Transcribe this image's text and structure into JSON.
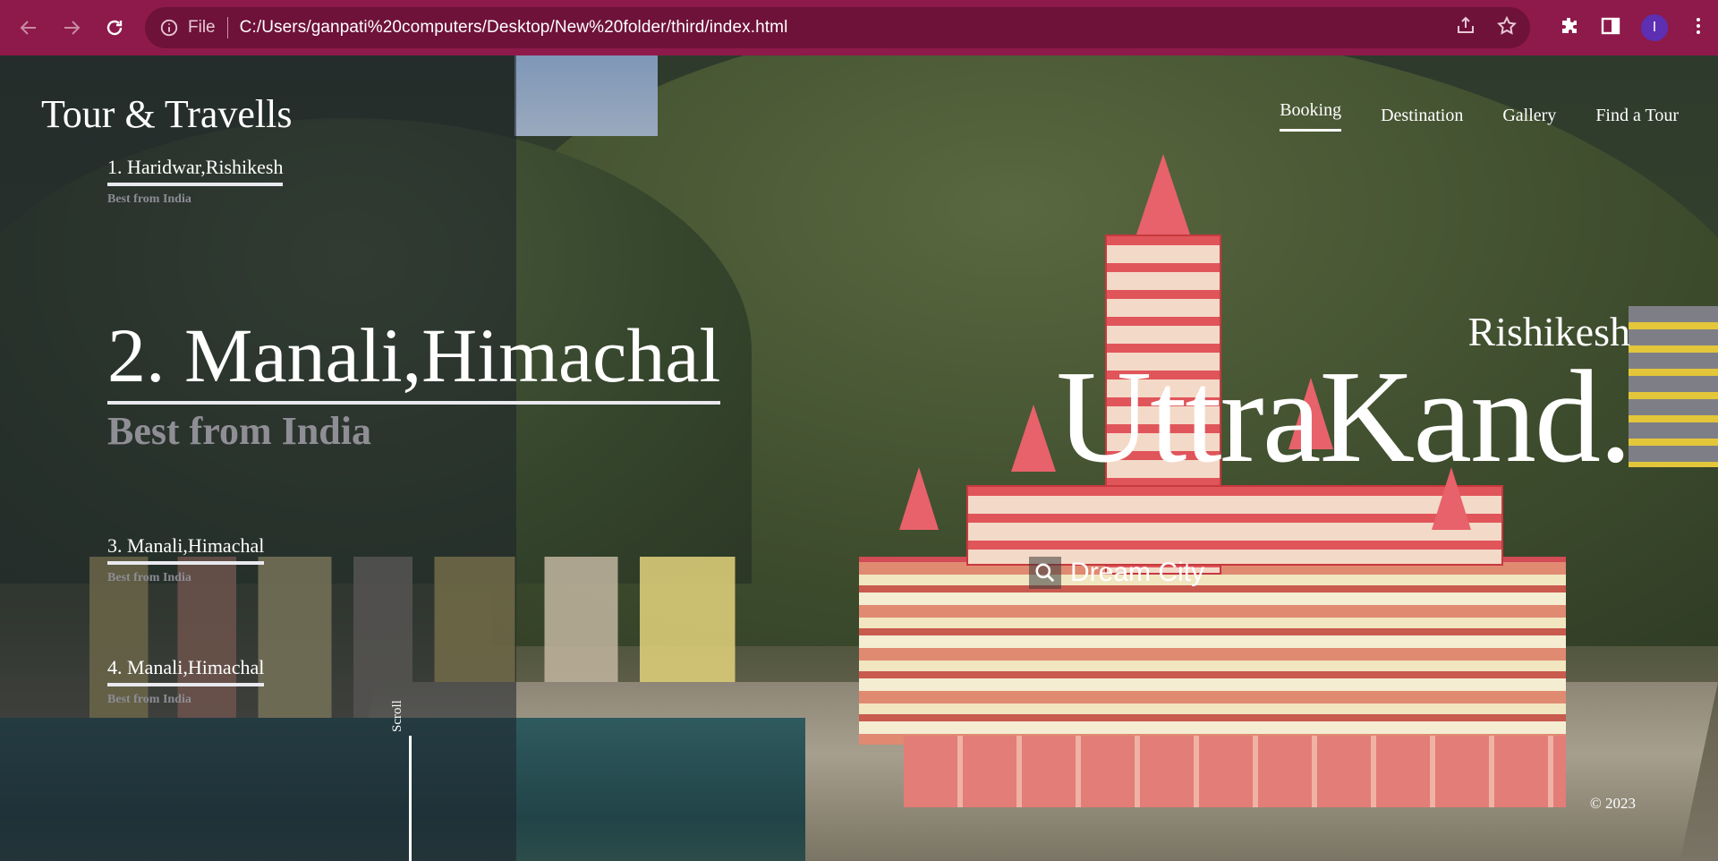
{
  "browser": {
    "file_label": "File",
    "url": "C:/Users/ganpati%20computers/Desktop/New%20folder/third/index.html",
    "profile_initial": "I",
    "theme_color": "#8d1a4a"
  },
  "site": {
    "brand": "Tour & Travells",
    "nav": [
      "Booking",
      "Destination",
      "Gallery",
      "Find a Tour"
    ],
    "active_nav": "Booking"
  },
  "tours": [
    {
      "title": "1. Haridwar,Rishikesh",
      "subtitle": "Best from India"
    },
    {
      "title": "2. Manali,Himachal",
      "subtitle": "Best from India"
    },
    {
      "title": "3. Manali,Himachal",
      "subtitle": "Best from India"
    },
    {
      "title": "4. Manali,Himachal",
      "subtitle": "Best from India"
    }
  ],
  "hero": {
    "city": "Rishikesh",
    "state": "UttraKand.",
    "search_label": "Dream City"
  },
  "scroll_label": "Scroll",
  "footer": {
    "copyright": "© 2023"
  }
}
